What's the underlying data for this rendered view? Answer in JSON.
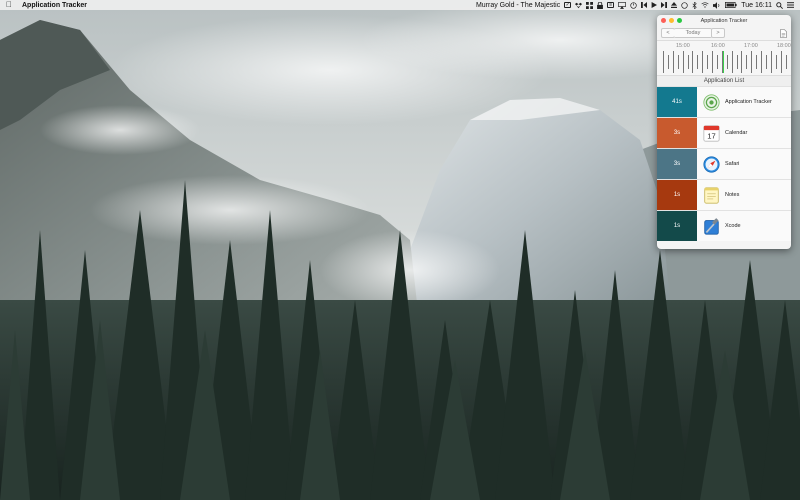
{
  "menubar": {
    "apple_icon": "apple-icon",
    "app_name": "Application Tracker",
    "now_playing": "Murray Gold - The Majestic",
    "time": "Tue 16:11"
  },
  "window": {
    "title": "Application Tracker",
    "toolbar": {
      "prev": "<",
      "today": "Today",
      "next": ">"
    },
    "timeline": {
      "labels": [
        "15:00",
        "16:00",
        "17:00",
        "18:00"
      ]
    },
    "list_header": "Application List",
    "apps": [
      {
        "duration": "41s",
        "name": "Application Tracker",
        "color": "#13798f",
        "icon": "target-icon"
      },
      {
        "duration": "3s",
        "name": "Calendar",
        "color": "#c85a2e",
        "icon": "calendar-icon"
      },
      {
        "duration": "3s",
        "name": "Safari",
        "color": "#4c7586",
        "icon": "compass-icon"
      },
      {
        "duration": "1s",
        "name": "Notes",
        "color": "#a6390f",
        "icon": "notes-icon"
      },
      {
        "duration": "1s",
        "name": "Xcode",
        "color": "#134a4a",
        "icon": "hammer-icon"
      }
    ],
    "calendar_day": "17"
  },
  "colors": {
    "now_indicator": "#3ad14a"
  }
}
